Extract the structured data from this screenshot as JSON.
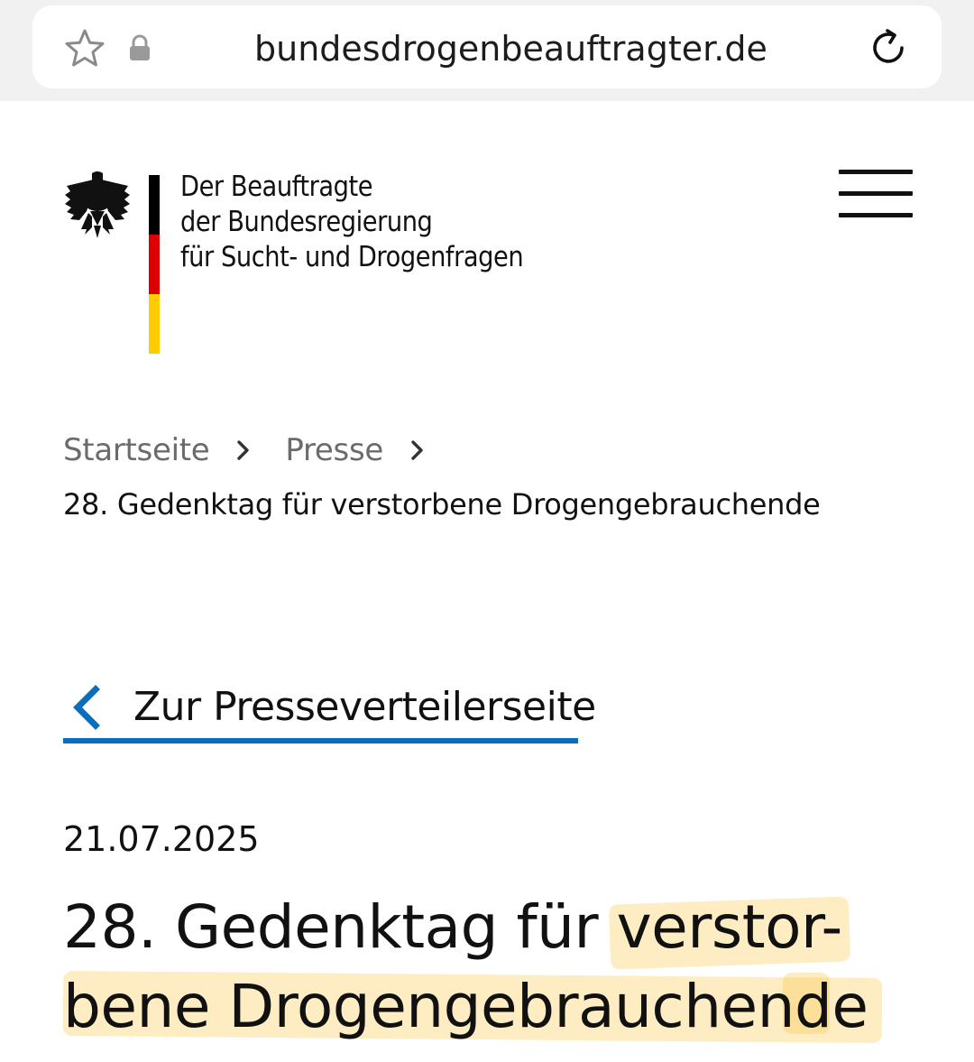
{
  "browser": {
    "url": "bundesdrogenbeauftragter.de",
    "icons": [
      "star-icon",
      "lock-icon",
      "reload-icon"
    ]
  },
  "header": {
    "org_lines": [
      "Der Beauftragte",
      "der Bundesregierung",
      "für Sucht- und Drogenfragen"
    ],
    "logo_icon": "federal-eagle-icon",
    "menu_icon": "hamburger-menu-icon",
    "flag_colors": [
      "#000000",
      "#dd0000",
      "#ffcc00"
    ]
  },
  "breadcrumb": {
    "items": [
      "Startseite",
      "Presse"
    ],
    "current": "28. Gedenktag für verstorbene Drogengebrauchende"
  },
  "back_link": {
    "label": "Zur Presseverteilerseite",
    "accent_color": "#0a6ebd"
  },
  "article": {
    "date": "21.07.2025",
    "title_lines": [
      "28. Gedenktag für verstor-",
      "bene Drogengebrauchende"
    ],
    "highlight_color": "#fcd678"
  }
}
